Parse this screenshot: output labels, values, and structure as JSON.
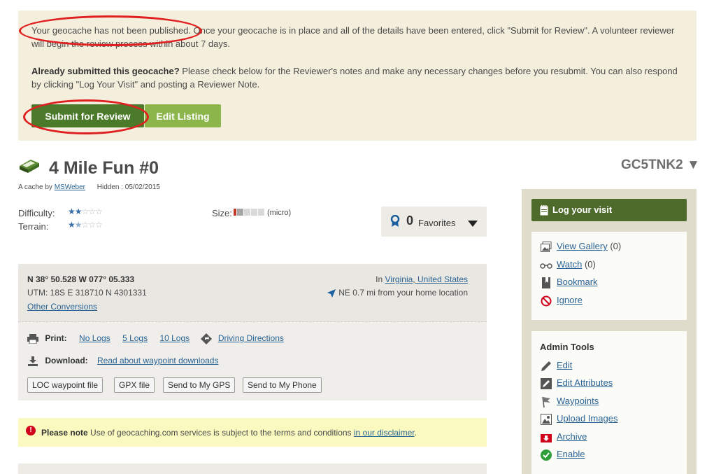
{
  "notice": {
    "p1_published": "Your geocache has not been published.",
    "p1_rest": " Once your geocache is in place and all of the details have been entered, click \"Submit for Review\". A volunteer reviewer will begin the review process within about 7 days.",
    "p2_bold": "Already submitted this geocache?",
    "p2_rest": " Please check below for the Reviewer's notes and make any necessary changes before you resubmit. You can also respond by clicking \"Log Your Visit\" and posting a Reviewer Note.",
    "submit_label": "Submit for Review",
    "edit_label": "Edit Listing"
  },
  "cache": {
    "title": "4 Mile Fun #0",
    "code": "GC5TNK2 ▼",
    "owner_prefix": "A cache by",
    "owner": "MSWeber",
    "hidden": "Hidden : 05/02/2015",
    "difficulty_label": "Difficulty:",
    "difficulty": 2,
    "terrain_label": "Terrain:",
    "terrain": 1.5,
    "size_label": "Size:",
    "size_text": "(micro)",
    "favorites_count": "0",
    "favorites_label": "Favorites"
  },
  "coords": {
    "latlon": "N 38° 50.528 W 077° 05.333",
    "utm": "UTM: 18S E 318710 N 4301331",
    "other": "Other Conversions",
    "in_prefix": "In",
    "location": "Virginia, United States",
    "distance": "NE 0.7 mi from your home location",
    "print_label": "Print:",
    "print_links": [
      "No Logs",
      "5 Logs",
      "10 Logs"
    ],
    "driving": "Driving Directions",
    "download_label": "Download:",
    "download_link": "Read about waypoint downloads",
    "buttons": [
      "LOC waypoint file",
      "GPX file",
      "Send to My GPS",
      "Send to My Phone"
    ]
  },
  "disclaimer": {
    "bold": "Please note",
    "text": " Use of geocaching.com services is subject to the terms and conditions ",
    "link": "in our disclaimer",
    "end": "."
  },
  "sidebar": {
    "log_label": "Log your visit",
    "gallery": "View Gallery",
    "gallery_count": " (0)",
    "watch": "Watch",
    "watch_count": " (0)",
    "bookmark": "Bookmark",
    "ignore": "Ignore",
    "admin_title": "Admin Tools",
    "admin_items": [
      "Edit",
      "Edit Attributes",
      "Waypoints",
      "Upload Images",
      "Archive",
      "Enable"
    ]
  },
  "colors": {
    "submit": "#4c7a2b",
    "edit": "#8cb54b",
    "log_button": "#4f6b2c",
    "highlight_ellipse": "#e02020"
  }
}
